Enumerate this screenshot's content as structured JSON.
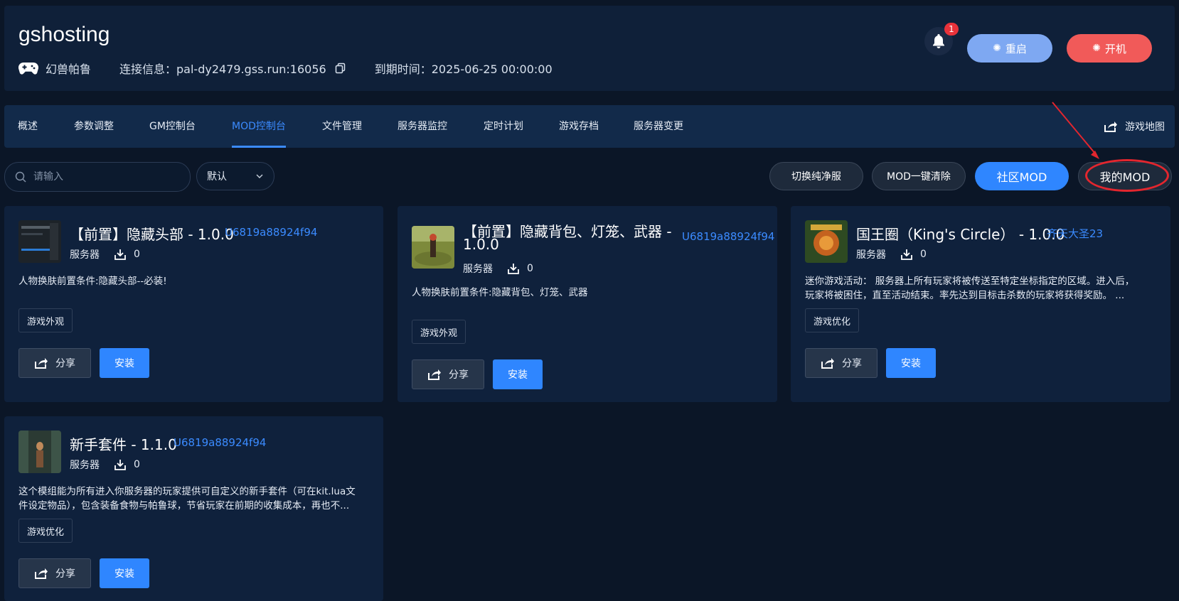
{
  "header": {
    "brand": "gshosting",
    "game": "幻兽帕鲁",
    "connection": "连接信息：pal-dy2479.gss.run:16056",
    "expiry": "到期时间：2025-06-25 00:00:00",
    "notification_count": "1",
    "restart_label": "重启",
    "start_label": "开机",
    "restart_color": "#7ea8f2",
    "start_color": "#f15a59"
  },
  "tabs": [
    {
      "label": "概述"
    },
    {
      "label": "参数调整"
    },
    {
      "label": "GM控制台"
    },
    {
      "label": "MOD控制台",
      "active": true
    },
    {
      "label": "文件管理"
    },
    {
      "label": "服务器监控"
    },
    {
      "label": "定时计划"
    },
    {
      "label": "游戏存档"
    },
    {
      "label": "服务器变更"
    }
  ],
  "map_link": "游戏地图",
  "toolbar": {
    "search_placeholder": "请输入",
    "sort_value": "默认",
    "switch_pure": "切换纯净服",
    "mod_clear": "MOD一键清除",
    "community_mod": "社区MOD",
    "my_mod": "我的MOD",
    "accent": "#2f86ff"
  },
  "cards": [
    {
      "title": "【前置】隐藏头部 - 1.0.0",
      "author": "U6819a88924f94",
      "platform": "服务器",
      "downloads": "0",
      "description": "人物换肤前置条件:隐藏头部--必装!",
      "tag": "游戏外观",
      "share": "分享",
      "install": "安装"
    },
    {
      "title_line1": "【前置】隐藏背包、灯笼、武器 -",
      "title_line2": "1.0.0",
      "author": "U6819a88924f94",
      "platform": "服务器",
      "downloads": "0",
      "description": "人物换肤前置条件:隐藏背包、灯笼、武器",
      "tag": "游戏外观",
      "share": "分享",
      "install": "安装"
    },
    {
      "title": "国王圈（King's Circle） - 1.0.0",
      "author": "齐天大圣23",
      "platform": "服务器",
      "downloads": "0",
      "description_line1": "迷你游戏活动： 服务器上所有玩家将被传送至特定坐标指定的区域。进入后，",
      "description_line2": "玩家将被困住，直至活动结束。率先达到目标击杀数的玩家将获得奖励。 ...",
      "tag": "游戏优化",
      "share": "分享",
      "install": "安装"
    },
    {
      "title": "新手套件 - 1.1.0",
      "author": "U6819a88924f94",
      "platform": "服务器",
      "downloads": "0",
      "description_line1": "这个模组能为所有进入你服务器的玩家提供可自定义的新手套件（可在kit.lua文",
      "description_line2": "件设定物品），包含装备食物与帕鲁球，节省玩家在前期的收集成本，再也不...",
      "tag": "游戏优化",
      "share": "分享",
      "install": "安装"
    }
  ]
}
